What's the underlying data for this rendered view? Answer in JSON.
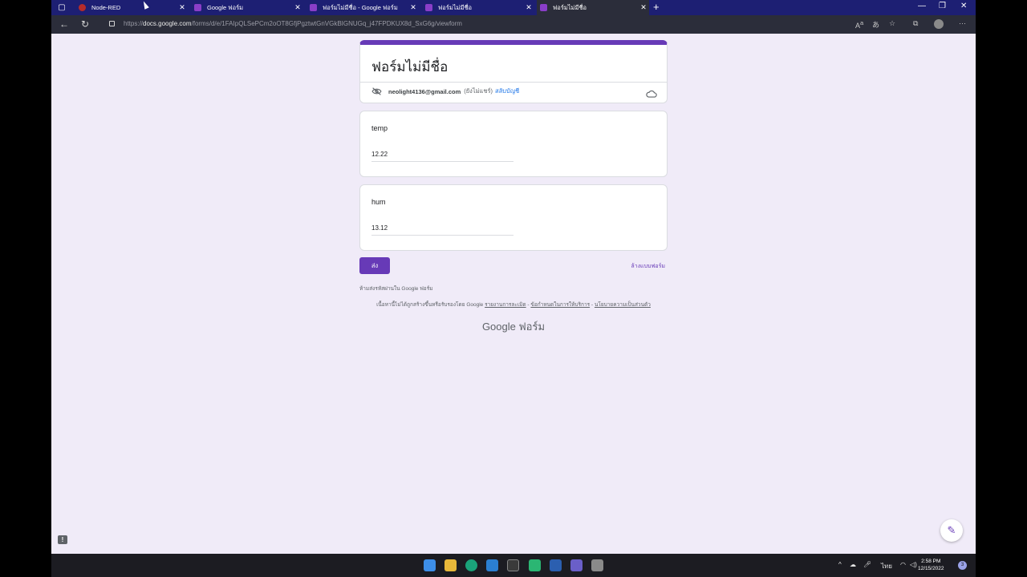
{
  "browser": {
    "tabs": [
      {
        "title": "Node-RED",
        "icon": "node-red-icon",
        "active": false
      },
      {
        "title": "Google ฟอร์ม",
        "icon": "google-forms-icon",
        "active": false
      },
      {
        "title": "ฟอร์มไม่มีชื่อ - Google ฟอร์ม",
        "icon": "google-forms-icon",
        "active": false
      },
      {
        "title": "ฟอร์มไม่มีชื่อ",
        "icon": "google-forms-icon",
        "active": false
      },
      {
        "title": "ฟอร์มไม่มีชื่อ",
        "icon": "google-forms-icon",
        "active": true
      }
    ],
    "url_scheme": "https://",
    "url_host": "docs.google.com",
    "url_path": "/forms/d/e/1FAIpQLSePCm2oOT8GfjPgztwtGnVGkBIGNUGq_j47FPDKUX8d_SxG6g/viewform"
  },
  "form": {
    "title": "ฟอร์มไม่มีชื่อ",
    "account_email": "neolight4136@gmail.com",
    "account_note": "(ยังไม่แชร์)",
    "switch_account": "สลับบัญชี",
    "questions": [
      {
        "label": "temp",
        "value": "12.22"
      },
      {
        "label": "hum",
        "value": "13.12"
      }
    ],
    "submit_label": "ส่ง",
    "clear_label": "ล้างแบบฟอร์ม",
    "no_password_note": "ห้ามส่งรหัสผ่านใน Google ฟอร์ม",
    "disclaimer_text": "เนื้อหานี้ไม่ได้ถูกสร้างขึ้นหรือรับรองโดย Google",
    "report_abuse": "รายงานการละเมิด",
    "terms": "ข้อกำหนดในการให้บริการ",
    "privacy": "นโยบายความเป็นส่วนตัว",
    "footer_brand": "Google ฟอร์ม"
  },
  "taskbar": {
    "language": "ไทย",
    "time": "2:58 PM",
    "date": "12/15/2022",
    "notification_count": "3"
  },
  "colors": {
    "accent": "#673ab7",
    "page_bg": "#f0ebf8",
    "tabstrip_bg": "#1d1f73"
  }
}
